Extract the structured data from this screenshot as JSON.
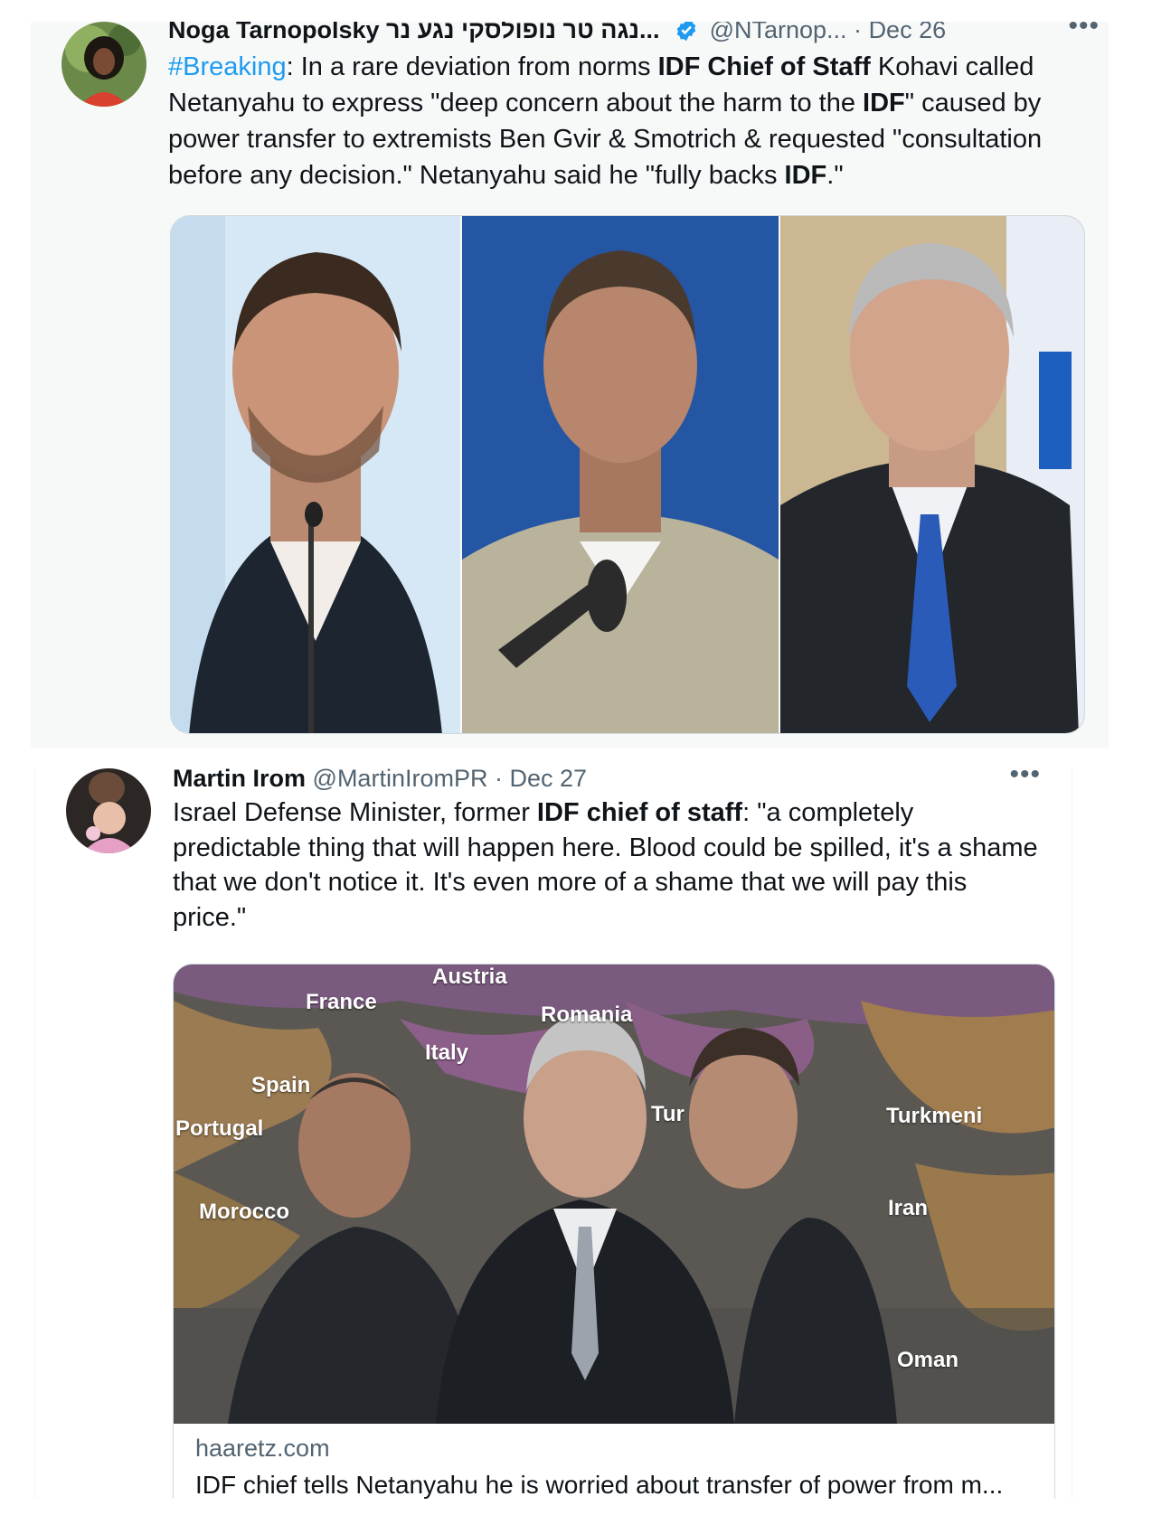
{
  "tweet1": {
    "author_name": "Noga Tarnopolsky נגה טרנופולסקי נגע נר",
    "author_name_display": "Noga Tarnopolsky נגה טר נופולסקי נגע נר...",
    "handle": "@NTarnop...",
    "separator": "·",
    "date": "Dec 26",
    "more": "•••",
    "text": {
      "hashtag": "#Breaking",
      "p1": ": In a rare deviation from norms ",
      "b1": "IDF Chief of Staff",
      "p2": " Kohavi called Netanyahu to express \"deep concern about the harm to the ",
      "b2": "IDF",
      "p3": "\" caused by power transfer to extremists Ben Gvir & Smotrich & requested \"consultation before any decision.\" Netanyahu said he \"fully backs ",
      "b3": "IDF",
      "p4": ".\""
    }
  },
  "tweet2": {
    "author_name": "Martin Irom",
    "handle": "@MartinIromPR",
    "separator": "·",
    "date": "Dec 27",
    "more": "•••",
    "text": {
      "p1": "Israel Defense Minister, former ",
      "b1": "IDF chief of staff",
      "p2": ": \"a completely predictable thing that will happen here. Blood could be spilled, it's a shame that we don't notice it. It's even more of a shame that we will pay this price.\""
    },
    "card": {
      "map_labels": {
        "austria": "Austria",
        "france": "France",
        "romania": "Romania",
        "italy": "Italy",
        "spain": "Spain",
        "portugal": "Portugal",
        "turkey": "Tur",
        "turkmenistan": "Turkmeni",
        "morocco": "Morocco",
        "iran": "Iran",
        "oman": "Oman"
      },
      "domain": "haaretz.com",
      "title": "IDF chief tells Netanyahu he is worried about transfer of power from m..."
    }
  },
  "colors": {
    "link_blue": "#1d9bf0",
    "secondary_text": "#536471",
    "primary_text": "#0f1419",
    "border": "#cfd9de",
    "tweet1_bg": "#f7f9f9"
  },
  "icons": [
    "verified-badge-icon",
    "more-options-icon"
  ]
}
